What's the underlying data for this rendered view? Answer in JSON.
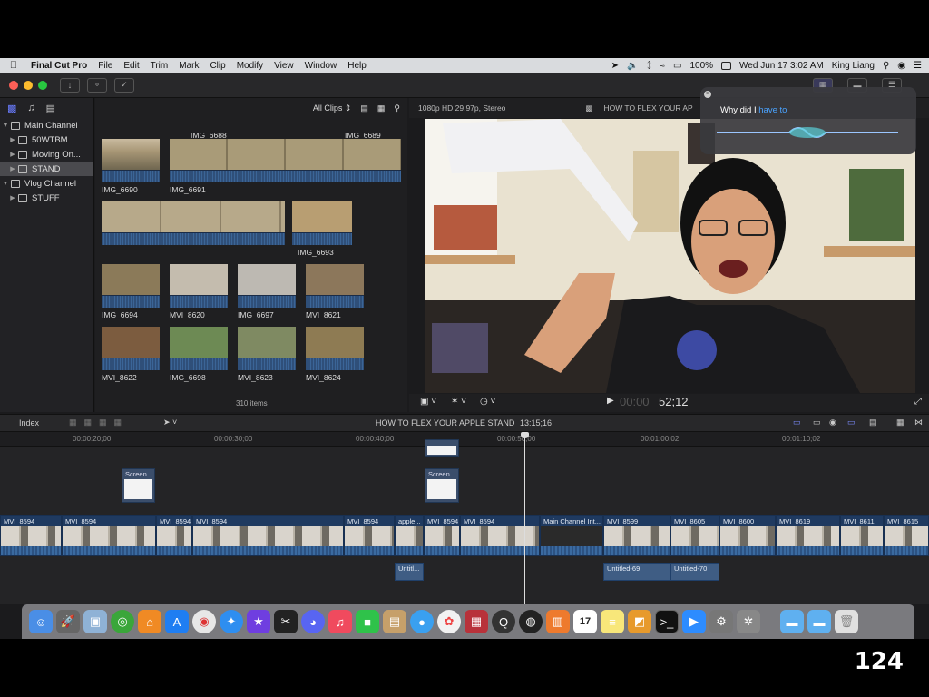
{
  "menubar": {
    "app_name": "Final Cut Pro",
    "items": [
      "File",
      "Edit",
      "Trim",
      "Mark",
      "Clip",
      "Modify",
      "View",
      "Window",
      "Help"
    ],
    "battery": "100%",
    "datetime": "Wed Jun 17  3:02 AM",
    "user": "King Liang"
  },
  "sidebar": {
    "libraries": [
      {
        "label": "Main Channel",
        "level": 0,
        "expanded": true,
        "selected": false
      },
      {
        "label": "50WTBM",
        "level": 1,
        "expanded": false,
        "selected": false
      },
      {
        "label": "Moving On...",
        "level": 1,
        "expanded": false,
        "selected": false
      },
      {
        "label": "STAND",
        "level": 1,
        "expanded": false,
        "selected": true
      },
      {
        "label": "Vlog Channel",
        "level": 0,
        "expanded": true,
        "selected": false
      },
      {
        "label": "STUFF",
        "level": 1,
        "expanded": false,
        "selected": false
      }
    ]
  },
  "browser": {
    "filter": "All Clips",
    "item_count": "310 items",
    "clips": [
      "IMG_6688",
      "IMG_6689",
      "IMG_6690",
      "IMG_6691",
      "IMG_6693",
      "IMG_6694",
      "MVI_8620",
      "IMG_6697",
      "MVI_8621",
      "MVI_8622",
      "IMG_6698",
      "MVI_8623",
      "MVI_8624"
    ]
  },
  "viewer": {
    "format": "1080p HD 29.97p, Stereo",
    "project_title": "HOW TO FLEX YOUR AP",
    "timecode": "52;12",
    "timecode_dim": "00:00"
  },
  "siri": {
    "prefix": "Why did I",
    "highlight": "have to"
  },
  "timeline": {
    "index_label": "Index",
    "project_name": "HOW TO FLEX YOUR APPLE STAND",
    "duration": "13:15;16",
    "ruler": [
      "00:00:20;00",
      "00:00:30;00",
      "00:00:40;00",
      "00:00:50;00",
      "00:01:00;02",
      "00:01:10;02"
    ],
    "broll": [
      "Screen...",
      "Screen..."
    ],
    "clips": [
      "MVI_8594",
      "MVI_8594",
      "MVI_8594",
      "MVI_8594",
      "MVI_8594",
      "apple...",
      "MVI_8594",
      "MVI_8594",
      "Main Channel Int...",
      "MVI_8599",
      "MVI_8605",
      "MVI_8600",
      "MVI_8619",
      "MVI_8611",
      "MVI_8615"
    ],
    "titles": [
      "Untitl...",
      "Untitled-69",
      "Untitled-70"
    ]
  },
  "dock": {
    "icons": [
      "finder-icon",
      "launchpad-icon",
      "preview-icon",
      "find-my-icon",
      "home-icon",
      "app-store-icon",
      "chrome-icon",
      "safari-icon",
      "imovie-icon",
      "final-cut-pro-icon",
      "discord-icon",
      "music-icon",
      "facetime-icon",
      "notefile-icon",
      "messages-icon",
      "photos-icon",
      "photo-booth-icon",
      "quicktime-icon",
      "obs-icon",
      "books-icon",
      "calendar-icon",
      "notes-icon",
      "vectorize-icon",
      "terminal-icon",
      "zoom-icon",
      "automator-icon",
      "system-preferences-icon",
      "folder-icon",
      "folder-icon",
      "trash-icon"
    ],
    "calendar_day": "17"
  },
  "page_number": "124",
  "colors": {
    "accent": "#2a6ad4",
    "waveform": "#2d4a72",
    "selected": "#4a4a4e"
  }
}
